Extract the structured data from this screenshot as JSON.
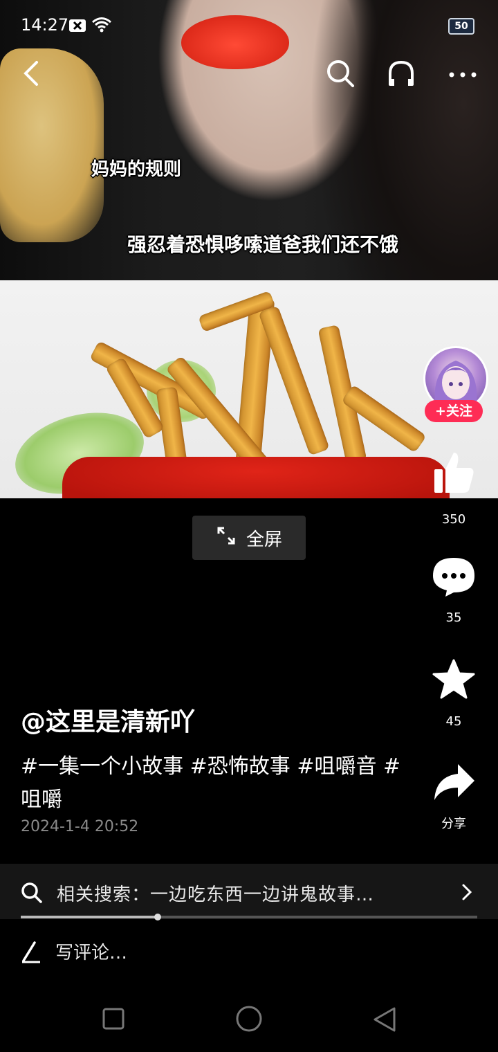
{
  "status_bar": {
    "time": "14:27",
    "battery": "50"
  },
  "video": {
    "captions": [
      "妈妈的规则",
      "强忍着恐惧哆嗦道爸我们还不饿"
    ],
    "progress_fraction": 0.3
  },
  "creator": {
    "follow_label": "+关注"
  },
  "actions": {
    "like_count": "350",
    "comment_count": "35",
    "favorite_count": "45",
    "share_label": "分享"
  },
  "fullscreen_label": "全屏",
  "post": {
    "author": "@这里是清新吖",
    "description": "#一集一个小故事 #恐怖故事 #咀嚼音 #咀嚼",
    "date": "2024-1-4 20:52"
  },
  "related_search": {
    "text": "相关搜索：一边吃东西一边讲鬼故事…"
  },
  "comment_input": {
    "placeholder": "写评论…"
  },
  "icons": {
    "back": "chevron-left-icon",
    "search": "search-icon",
    "listen": "headphones-icon",
    "more": "more-icon"
  }
}
